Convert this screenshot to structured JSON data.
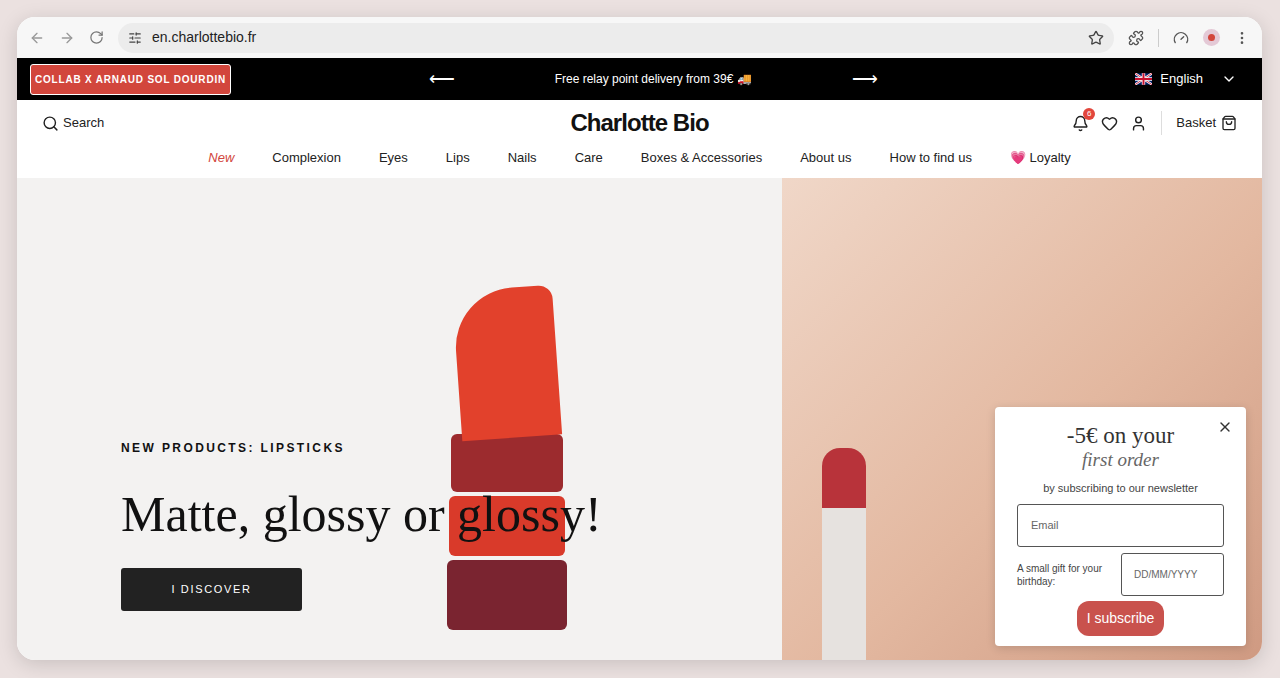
{
  "browser": {
    "url": "en.charlottebio.fr",
    "bookmarked": false
  },
  "announcement_bar": {
    "collab_button": "COLLAB X ARNAUD SOL DOURDIN",
    "prev": "⟵",
    "message": "Free relay point delivery from 39€ 🚚",
    "next": "⟶",
    "language": "English"
  },
  "header": {
    "search": "Search",
    "logo": "Charlotte Bio",
    "notifications_badge": "6",
    "basket": "Basket"
  },
  "nav": [
    {
      "label": "New",
      "highlighted": true
    },
    {
      "label": "Complexion",
      "highlighted": false
    },
    {
      "label": "Eyes",
      "highlighted": false
    },
    {
      "label": "Lips",
      "highlighted": false
    },
    {
      "label": "Nails",
      "highlighted": false
    },
    {
      "label": "Care",
      "highlighted": false
    },
    {
      "label": "Boxes & Accessories",
      "highlighted": false
    },
    {
      "label": "About us",
      "highlighted": false
    },
    {
      "label": "How to find us",
      "highlighted": false
    },
    {
      "label": "💗 Loyalty",
      "highlighted": false
    }
  ],
  "hero": {
    "eyebrow": "NEW PRODUCTS: LIPSTICKS",
    "title": "Matte, glossy or glossy!",
    "button": "I DISCOVER"
  },
  "popup": {
    "title_line1": "-5€ on your",
    "title_line2": "first order",
    "subtitle": "by subscribing to our newsletter",
    "email_placeholder": "Email",
    "birthday_label": "A small gift for your birthday:",
    "birthday_placeholder": "DD/MM/YYYY",
    "submit": "I subscribe"
  }
}
